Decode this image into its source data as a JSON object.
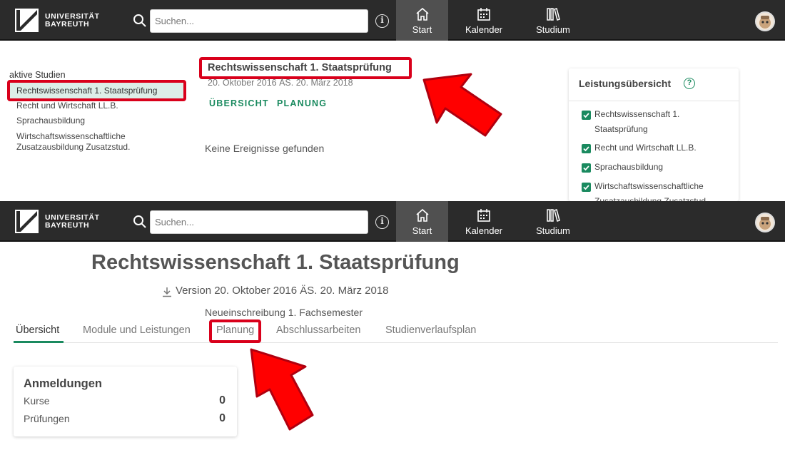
{
  "header": {
    "logo_line1": "UNIVERSITÄT",
    "logo_line2": "BAYREUTH",
    "search_placeholder": "Suchen...",
    "nav": [
      {
        "label": "Start",
        "icon": "home-icon",
        "active": true
      },
      {
        "label": "Kalender",
        "icon": "calendar-icon",
        "active": false
      },
      {
        "label": "Studium",
        "icon": "books-icon",
        "active": false
      }
    ]
  },
  "start": {
    "section_title": "aktive Studien",
    "studies": [
      "Rechtswissenschaft 1. Staatsprüfung",
      "Recht und Wirtschaft LL.B.",
      "Sprachausbildung",
      "Wirtschaftswissenschaftliche Zusatzausbildung Zusatzstud."
    ],
    "main_title": "Rechtswissenschaft 1. Staatsprüfung",
    "version": "20. Oktober 2016 ÄS. 20. März 2018",
    "links": [
      "ÜBERSICHT",
      "PLANUNG"
    ],
    "no_events": "Keine Ereignisse gefunden",
    "performance": {
      "title": "Leistungsübersicht",
      "items": [
        "Rechtswissenschaft 1. Staatsprüfung",
        "Recht und Wirtschaft LL.B.",
        "Sprachausbildung",
        "Wirtschaftswissenschaftliche Zusatzausbildung Zusatzstud."
      ]
    }
  },
  "study": {
    "title": "Rechtswissenschaft 1. Staatsprüfung",
    "version": "Version 20. Oktober 2016 ÄS. 20. März 2018",
    "enrollment": "Neueinschreibung 1. Fachsemester",
    "tabs": [
      "Übersicht",
      "Module und Leistungen",
      "Planung",
      "Abschlussarbeiten",
      "Studienverlaufsplan"
    ],
    "registrations": {
      "title": "Anmeldungen",
      "rows": [
        {
          "label": "Kurse",
          "value": "0"
        },
        {
          "label": "Prüfungen",
          "value": "0"
        }
      ]
    }
  },
  "colors": {
    "header_bg": "#2b2b2b",
    "accent_green": "#1a8a5f",
    "highlight_red": "#d9001b"
  }
}
